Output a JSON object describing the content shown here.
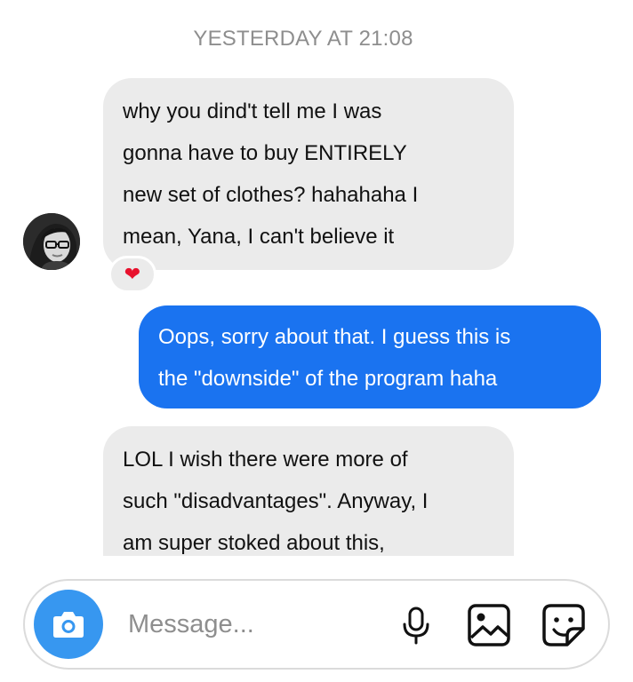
{
  "thread": {
    "timestamp": "YESTERDAY AT 21:08",
    "messages": [
      {
        "direction": "incoming",
        "text": "why you dind't tell me I was\ngonna have to buy ENTIRELY\nnew set of clothes? hahahaha I\nmean, Yana, I can't believe it",
        "reaction": "❤"
      },
      {
        "direction": "outgoing",
        "text": "Oops, sorry about that. I guess this is\nthe \"downside\" of the program haha"
      },
      {
        "direction": "incoming",
        "text": "LOL I wish there were more of\nsuch \"disadvantages\". Anyway, I\nam super stoked about this,"
      }
    ],
    "sender_avatar": "avatar-photo"
  },
  "composer": {
    "placeholder": "Message...",
    "value": "",
    "icons": {
      "camera": "camera-icon",
      "microphone": "microphone-icon",
      "gallery": "image-gallery-icon",
      "sticker": "sticker-icon"
    }
  },
  "colors": {
    "incoming_bubble": "#ebebeb",
    "outgoing_bubble": "#1a73f0",
    "camera_button": "#3797f0",
    "timestamp": "#8e8e8e",
    "reaction_heart": "#e8112d"
  }
}
